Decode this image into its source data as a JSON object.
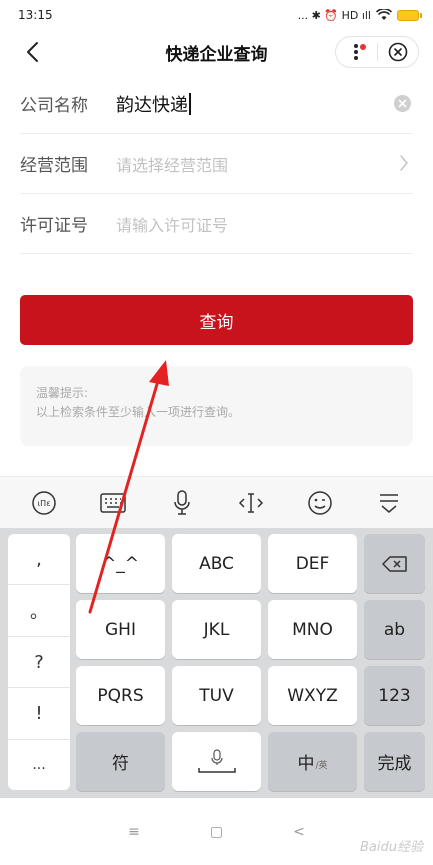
{
  "status_bar": {
    "time": "13:15",
    "indicators": "... ✱ ⏰ HD ıll",
    "icons": [
      "bluetooth-icon",
      "alarm-icon",
      "signal-icon",
      "wifi-icon",
      "battery-icon"
    ],
    "battery_color": "#ffc71e"
  },
  "nav": {
    "title": "快递企业查询",
    "back_icon": "back-arrow-icon",
    "more_icon": "more-dots-icon",
    "close_icon": "close-circle-icon",
    "badge_color": "#e8332e"
  },
  "form": {
    "company": {
      "label": "公司名称",
      "value": "韵达快递"
    },
    "scope": {
      "label": "经营范围",
      "placeholder": "请选择经营范围"
    },
    "license": {
      "label": "许可证号",
      "placeholder": "请输入许可证号"
    }
  },
  "query_button": {
    "label": "查询",
    "color": "#c8121c"
  },
  "tip": {
    "title": "温馨提示:",
    "text": "以上检索条件至少输入一项进行查询。"
  },
  "keyboard_toolbar": {
    "icons": [
      "emoji-mode-icon",
      "keyboard-icon",
      "microphone-icon",
      "cursor-move-icon",
      "smiley-icon",
      "collapse-keyboard-icon"
    ]
  },
  "keyboard": {
    "punctuation": [
      ",",
      "。",
      "?",
      "!",
      "..."
    ],
    "row1": [
      "^_^",
      "ABC",
      "DEF"
    ],
    "row2": [
      "GHI",
      "JKL",
      "MNO",
      "ab"
    ],
    "row3": [
      "PQRS",
      "TUV",
      "WXYZ",
      "123"
    ],
    "row4": {
      "symbols": "符",
      "lang_main": "中",
      "lang_sub": "/英",
      "done": "完成"
    }
  },
  "system_nav": {
    "menu": "≡",
    "home": "▢",
    "back": "<"
  },
  "watermark": "Baidu经验"
}
